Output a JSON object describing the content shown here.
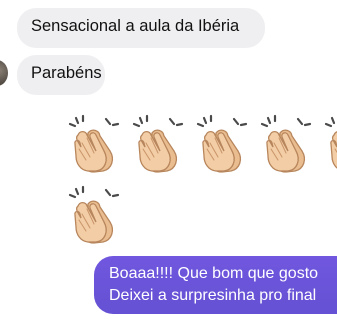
{
  "messages": [
    {
      "direction": "incoming",
      "text": "Sensacional a aula da Ibéria"
    },
    {
      "direction": "incoming",
      "text": "Parabéns"
    },
    {
      "direction": "incoming",
      "emoji": "clapping-hands",
      "count": 6
    },
    {
      "direction": "outgoing",
      "lines": [
        "Boaaa!!!! Que bom que gosto",
        "Deixei a surpresinha pro final"
      ]
    }
  ],
  "colors": {
    "incoming_bubble": "#efeff1",
    "outgoing_bubble": "#6a56d8",
    "clap_skin": "#f0c9a0",
    "clap_outline": "#b8865c"
  }
}
